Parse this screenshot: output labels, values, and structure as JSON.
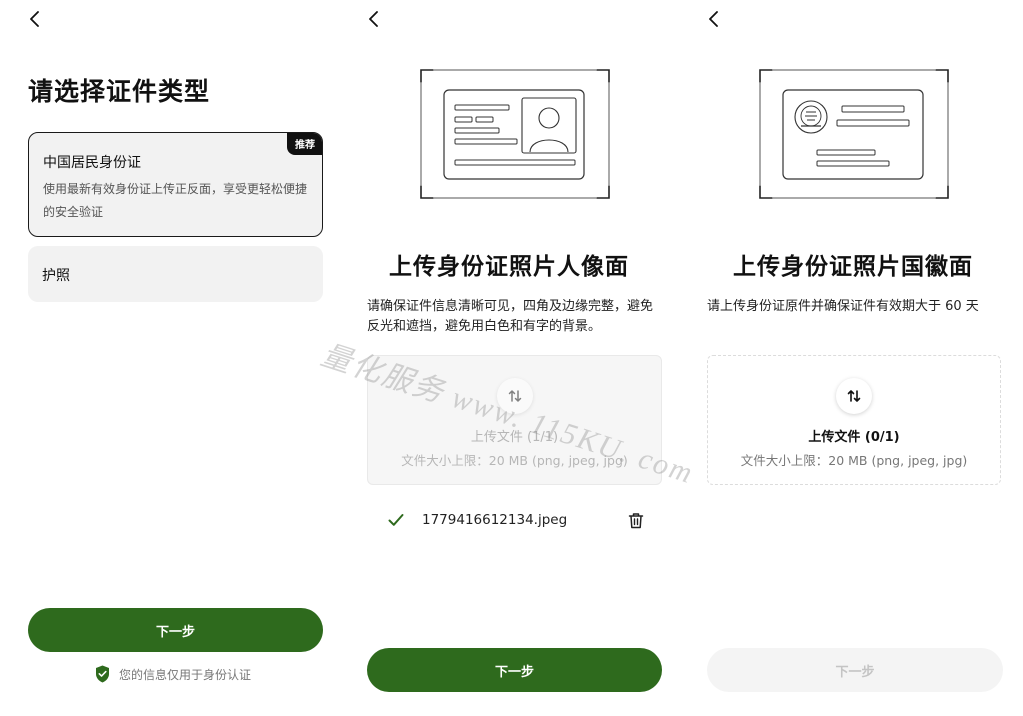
{
  "panel1": {
    "title": "请选择证件类型",
    "id_card": {
      "name": "中国居民身份证",
      "badge": "推荐",
      "desc": "使用最新有效身份证上传正反面，享受更轻松便捷的安全验证"
    },
    "passport": {
      "name": "护照"
    },
    "next_label": "下一步",
    "privacy_text": "您的信息仅用于身份认证"
  },
  "panel2": {
    "heading": "上传身份证照片人像面",
    "instruction": "请确保证件信息清晰可见，四角及边缘完整，避免反光和遮挡，避免用白色和有字的背景。",
    "upload": {
      "label": "上传文件 (1/1)",
      "limit": "文件大小上限：20 MB (png, jpeg, jpg)",
      "state": "disabled"
    },
    "file": {
      "name": "1779416612134.jpeg",
      "status": "uploaded"
    },
    "next_label": "下一步"
  },
  "panel3": {
    "heading": "上传身份证照片国徽面",
    "instruction": "请上传身份证原件并确保证件有效期大于 60 天",
    "upload": {
      "label": "上传文件 (0/1)",
      "limit": "文件大小上限：20 MB (png, jpeg, jpg)",
      "state": "active"
    },
    "next_label": "下一步",
    "next_state": "disabled"
  },
  "watermark": "量化服务 www. 115KU. com",
  "colors": {
    "primary": "#2e6a1d",
    "disabled_bg": "#f4f4f4",
    "card_bg": "#f2f2f2",
    "text": "#111111"
  },
  "icons": [
    "chevron-left-icon",
    "shield-check-icon",
    "upload-swap-icon",
    "check-icon",
    "trash-icon",
    "id-card-front-illustration",
    "id-card-back-illustration"
  ]
}
